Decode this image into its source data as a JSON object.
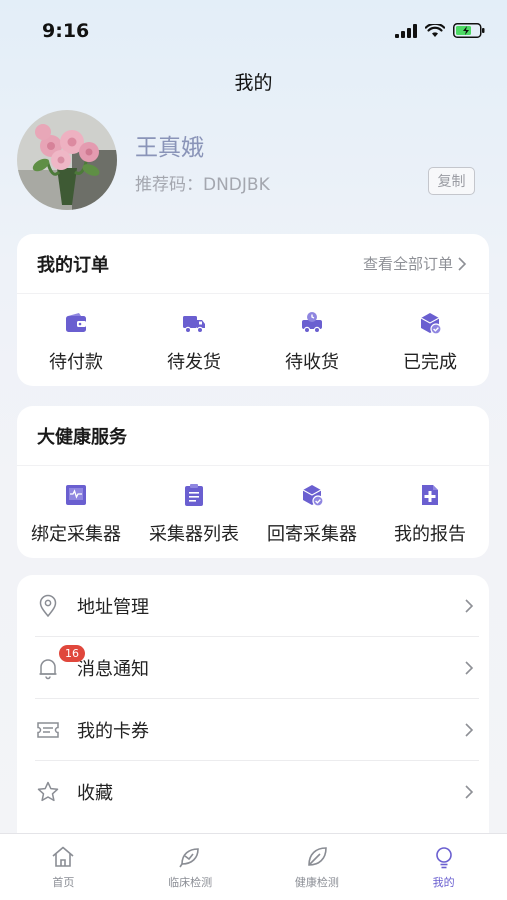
{
  "status_bar": {
    "time": "9:16"
  },
  "header": {
    "title": "我的"
  },
  "profile": {
    "name": "王真娥",
    "referral_code": "推荐码：DNDJBK",
    "copy_label": "复制"
  },
  "orders": {
    "title": "我的订单",
    "view_all": "查看全部订单",
    "items": [
      {
        "label": "待付款",
        "icon": "wallet-icon"
      },
      {
        "label": "待发货",
        "icon": "truck-icon"
      },
      {
        "label": "待收货",
        "icon": "delivery-icon"
      },
      {
        "label": "已完成",
        "icon": "box-check-icon"
      }
    ]
  },
  "health": {
    "title": "大健康服务",
    "items": [
      {
        "label": "绑定采集器",
        "icon": "monitor-icon"
      },
      {
        "label": "采集器列表",
        "icon": "clipboard-icon"
      },
      {
        "label": "回寄采集器",
        "icon": "return-box-icon"
      },
      {
        "label": "我的报告",
        "icon": "medical-report-icon"
      }
    ]
  },
  "menu": {
    "items": [
      {
        "label": "地址管理",
        "icon": "location-icon"
      },
      {
        "label": "消息通知",
        "icon": "bell-icon",
        "badge": "16"
      },
      {
        "label": "我的卡券",
        "icon": "ticket-icon"
      },
      {
        "label": "收藏",
        "icon": "star-icon"
      }
    ]
  },
  "tab_bar": {
    "items": [
      {
        "label": "首页",
        "icon": "home-icon"
      },
      {
        "label": "临床检测",
        "icon": "leaf-test-icon"
      },
      {
        "label": "健康检测",
        "icon": "leaf-icon"
      },
      {
        "label": "我的",
        "icon": "bulb-icon",
        "active": true
      }
    ]
  },
  "colors": {
    "accent": "#6a5fd0",
    "badge": "#e0473c",
    "name": "#8a94b8"
  }
}
